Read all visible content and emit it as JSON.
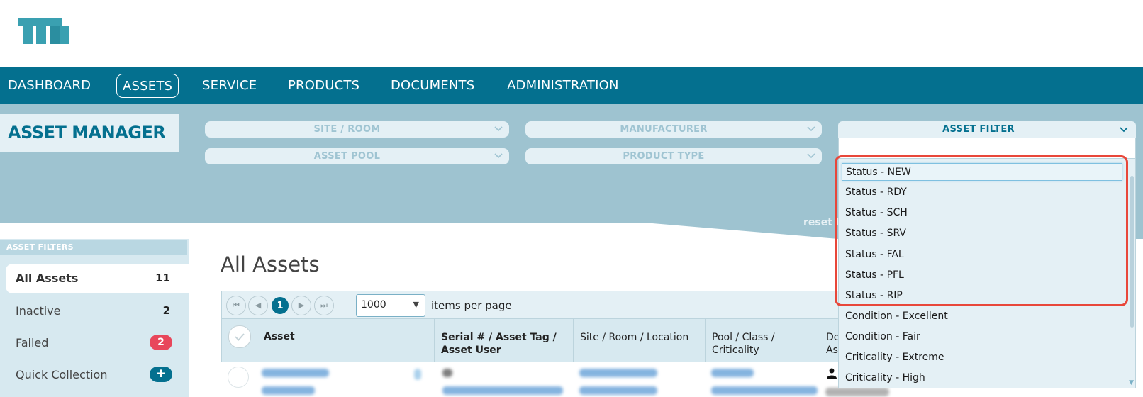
{
  "nav": {
    "items": [
      {
        "label": "DASHBOARD"
      },
      {
        "label": "ASSETS"
      },
      {
        "label": "SERVICE"
      },
      {
        "label": "PRODUCTS"
      },
      {
        "label": "DOCUMENTS"
      },
      {
        "label": "ADMINISTRATION"
      }
    ],
    "active": "ASSETS"
  },
  "page_title": "ASSET MANAGER",
  "filters": {
    "site_room": "SITE / ROOM",
    "manufacturer": "MANUFACTURER",
    "asset_pool": "ASSET POOL",
    "product_type": "PRODUCT TYPE",
    "asset_filter": "ASSET FILTER",
    "asset_filter_input": "",
    "reset_text": "reset f",
    "options": [
      "Status - NEW",
      "Status - RDY",
      "Status - SCH",
      "Status - SRV",
      "Status - FAL",
      "Status - PFL",
      "Status - RIP",
      "Condition - Excellent",
      "Condition - Fair",
      "Criticality - Extreme",
      "Criticality - High"
    ],
    "highlighted_option": "Status - NEW"
  },
  "sidebar": {
    "heading": "ASSET FILTERS",
    "items": [
      {
        "label": "All Assets",
        "count": "11"
      },
      {
        "label": "Inactive",
        "count": "2"
      },
      {
        "label": "Failed",
        "count": "2"
      },
      {
        "label": "Quick Collection",
        "count": "+"
      }
    ]
  },
  "main": {
    "title": "All Assets",
    "pager": {
      "current_page": "1",
      "per_page": "1000",
      "per_page_label": "items per page"
    },
    "columns": [
      {
        "line1": "Asset",
        "line2": ""
      },
      {
        "line1": "Serial # / Asset Tag /",
        "line2": "Asset User"
      },
      {
        "line1": "Site / Room / Location",
        "line2": ""
      },
      {
        "line1": "Pool / Class /",
        "line2": "Criticality"
      },
      {
        "line1": "De",
        "line2": "Ass"
      }
    ]
  },
  "colors": {
    "brand": "#04708f",
    "filter_band": "#9ec3d0",
    "highlight_outline": "#e8473a",
    "badge_red": "#e8475b"
  }
}
